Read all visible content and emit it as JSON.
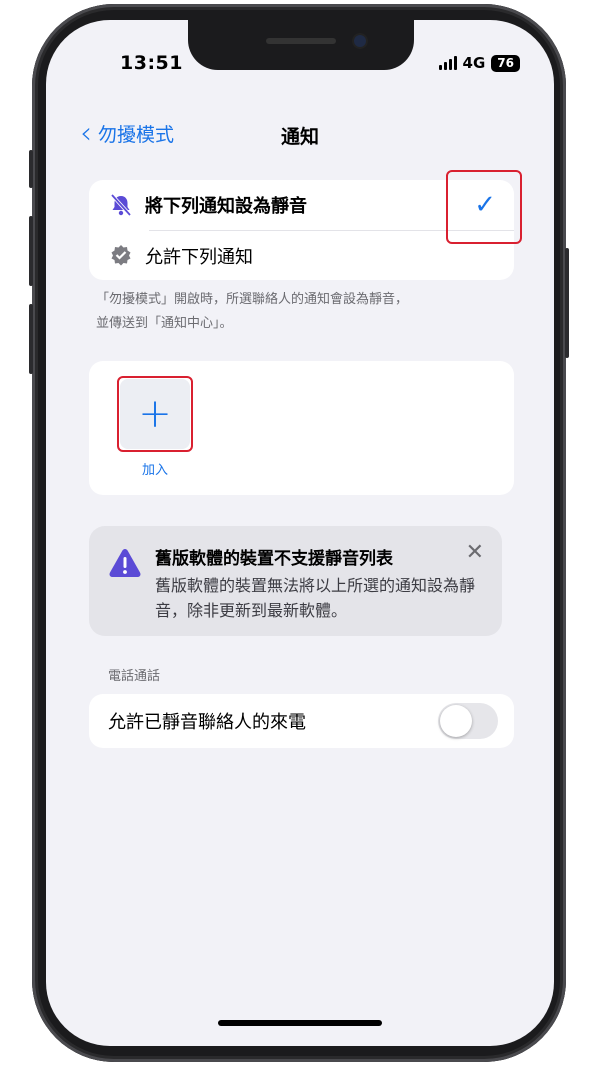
{
  "status_bar": {
    "time": "13:51",
    "network": "4G",
    "battery": "76"
  },
  "nav": {
    "back_label": "勿擾模式",
    "title": "通知"
  },
  "mode_options": {
    "items": [
      {
        "label": "將下列通知設為靜音",
        "icon": "bell-slash-icon",
        "selected": true
      },
      {
        "label": "允許下列通知",
        "icon": "checkmark-seal-icon",
        "selected": false
      }
    ]
  },
  "footnote": {
    "line1": "「勿擾模式」開啟時，所選聯絡人的通知會設為靜音，",
    "line2": "並傳送到「通知中心」。"
  },
  "add": {
    "label": "加入",
    "icon": "plus-icon"
  },
  "banner": {
    "title": "舊版軟體的裝置不支援靜音列表",
    "body": "舊版軟體的裝置無法將以上所選的通知設為靜音，除非更新到最新軟體。",
    "icon": "warning-triangle-icon",
    "close_icon": "close-icon"
  },
  "calls": {
    "section_header": "電話通話",
    "toggle_label": "允許已靜音聯絡人的來電",
    "toggle_on": false
  },
  "colors": {
    "accent": "#1a74e8",
    "warning": "#5b4bd6",
    "highlight": "#d92030"
  }
}
